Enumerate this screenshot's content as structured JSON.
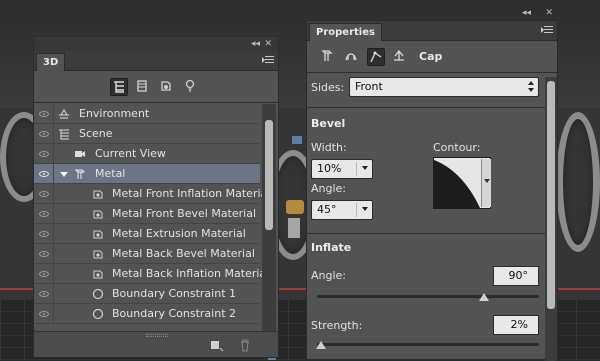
{
  "panel_3d": {
    "tab": "3D",
    "filter_tools": [
      "whole-scene-icon",
      "meshes-icon",
      "materials-icon",
      "lights-icon"
    ],
    "items": [
      {
        "label": "Environment",
        "icon": "environment-icon",
        "indent": 0
      },
      {
        "label": "Scene",
        "icon": "scene-icon",
        "indent": 0
      },
      {
        "label": "Current View",
        "icon": "camera-icon",
        "indent": 1
      },
      {
        "label": "Metal",
        "icon": "mesh-icon",
        "indent": 0,
        "selected": true,
        "expanded": true
      },
      {
        "label": "Metal Front Inflation Material",
        "icon": "material-icon",
        "indent": 2
      },
      {
        "label": "Metal Front Bevel Material",
        "icon": "material-icon",
        "indent": 2
      },
      {
        "label": "Metal Extrusion Material",
        "icon": "material-icon",
        "indent": 2
      },
      {
        "label": "Metal Back Bevel Material",
        "icon": "material-icon",
        "indent": 2
      },
      {
        "label": "Metal Back Inflation Material",
        "icon": "material-icon",
        "indent": 2
      },
      {
        "label": "Boundary Constraint 1",
        "icon": "constraint-icon",
        "indent": 2
      },
      {
        "label": "Boundary Constraint 2",
        "icon": "constraint-icon",
        "indent": 2
      }
    ]
  },
  "properties": {
    "tab": "Properties",
    "mode_tools": [
      "mesh-icon",
      "deform-icon",
      "cap-icon",
      "coordinates-icon"
    ],
    "mode_label": "Cap",
    "sides": {
      "label": "Sides:",
      "value": "Front"
    },
    "bevel": {
      "heading": "Bevel",
      "width_label": "Width:",
      "width_value": "10%",
      "contour_label": "Contour:",
      "angle_label": "Angle:",
      "angle_value": "45°"
    },
    "inflate": {
      "heading": "Inflate",
      "angle_label": "Angle:",
      "angle_value": "90°",
      "angle_fraction": 0.75,
      "strength_label": "Strength:",
      "strength_value": "2%",
      "strength_fraction": 0.02
    }
  },
  "colors": {
    "selection": "#6b7586",
    "panel_bg": "#535353",
    "accent_red": "#a33a3a"
  }
}
